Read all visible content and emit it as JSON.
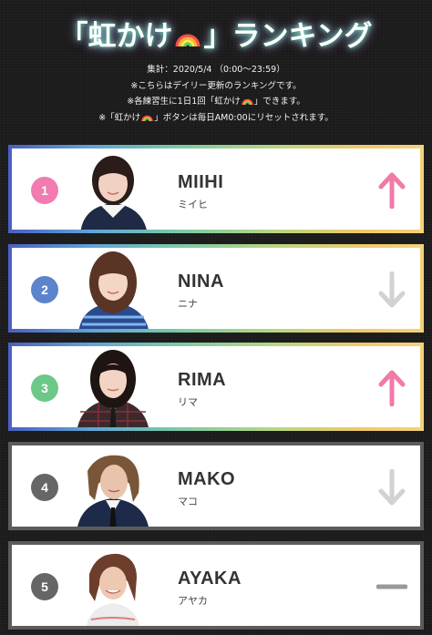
{
  "header": {
    "title_open": "「虹かけ",
    "title_close": "」ランキング",
    "notes": [
      "集計：2020/5/4 （0:00〜23:59）",
      "※こちらはデイリー更新のランキングです。",
      "※各練習生に1日1回「虹かけ",
      "」できます。",
      "※「虹かけ",
      "」ボタンは毎日AM0:00にリセットされます。"
    ]
  },
  "colors": {
    "rank1": "#f27bb0",
    "rank2": "#5b84cc",
    "rank3": "#6cc889",
    "rank4": "#666666",
    "rank5": "#666666",
    "up": "#f07aa8",
    "down": "#d2d2d2",
    "flat": "#999999"
  },
  "ranking": [
    {
      "rank": "1",
      "name": "MIIHI",
      "kana": "ミイヒ",
      "trend": "up-arrow-icon",
      "frame": "rainbow"
    },
    {
      "rank": "2",
      "name": "NINA",
      "kana": "ニナ",
      "trend": "down-arrow-icon",
      "frame": "rainbow"
    },
    {
      "rank": "3",
      "name": "RIMA",
      "kana": "リマ",
      "trend": "up-arrow-icon",
      "frame": "rainbow"
    },
    {
      "rank": "4",
      "name": "MAKO",
      "kana": "マコ",
      "trend": "down-arrow-icon",
      "frame": "grey"
    },
    {
      "rank": "5",
      "name": "AYAKA",
      "kana": "アヤカ",
      "trend": "dash-icon",
      "frame": "grey"
    }
  ]
}
